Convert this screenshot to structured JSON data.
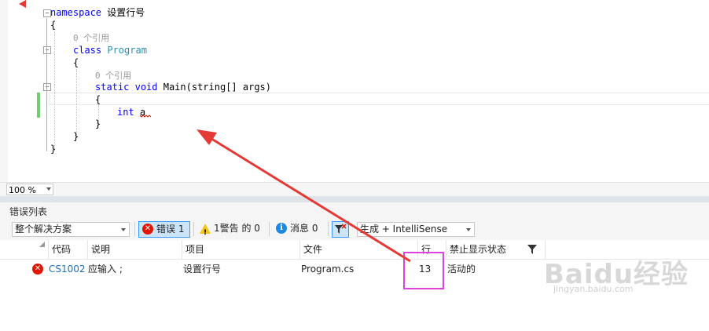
{
  "editor": {
    "lines": {
      "l1_kw": "namespace",
      "l1_name": " 设置行号",
      "l2": "{",
      "l3_ref": "0 个引用",
      "l4_kw": "class",
      "l4_type": "Program",
      "l5": "{",
      "l6_ref": "0 个引用",
      "l7_kw1": "static",
      "l7_kw2": "void",
      "l7_rest": " Main(string[] args)",
      "l8": "{",
      "l9_kw": "int",
      "l9_rest": " a",
      "l10": "}",
      "l11": "}",
      "l12": "}"
    },
    "zoom_level": "100 %"
  },
  "error_panel": {
    "title": "错误列表",
    "scope_dropdown": "整个解决方案",
    "errors_button": "错误 1",
    "warnings_button": "1警告 的 0",
    "messages_button": "消息 0",
    "build_dropdown": "生成 + IntelliSense",
    "columns": {
      "code": "代码",
      "description": "说明",
      "project": "项目",
      "file": "文件",
      "line": "行",
      "suppression": "禁止显示状态"
    },
    "rows": [
      {
        "code": "CS1002",
        "description": "应输入 ;",
        "project": "设置行号",
        "file": "Program.cs",
        "line": "13",
        "suppression": "活动的"
      }
    ]
  },
  "watermark": {
    "brand": "Baidu经验",
    "url": "jingyan.baidu.com"
  },
  "colors": {
    "keyword": "#0000ff",
    "type": "#2b91af",
    "error": "#e51400",
    "annotation_arrow": "#e53935",
    "highlight_box": "#e040e0"
  }
}
